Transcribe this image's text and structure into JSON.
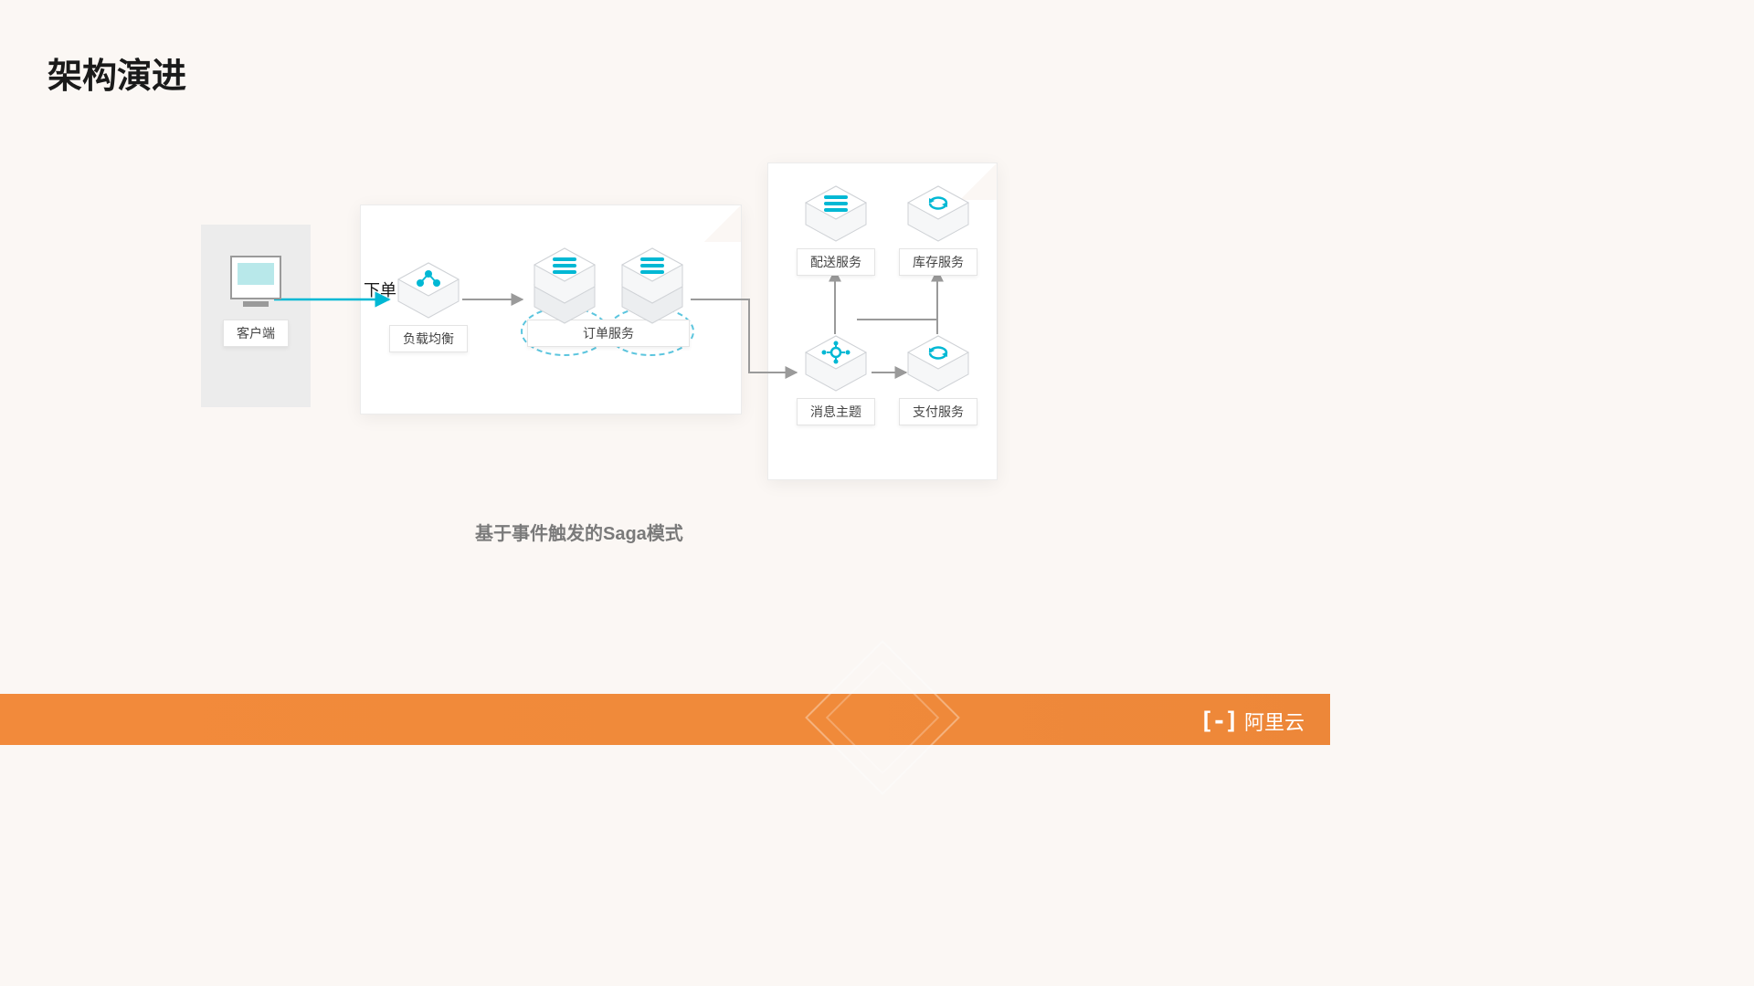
{
  "title": "架构演进",
  "caption": "基于事件触发的Saga模式",
  "footer_brand": "阿里云",
  "edge_label_order": "下单",
  "nodes": {
    "client": "客户端",
    "lb": "负载均衡",
    "order": "订单服务",
    "delivery": "配送服务",
    "inventory": "库存服务",
    "topic": "消息主题",
    "payment": "支付服务"
  },
  "colors": {
    "accent": "#00b8d4",
    "footer": "#f28a3b",
    "line_gray": "#9a9a9a",
    "hex_top": "#f3f4f5",
    "hex_side": "#d8dadd"
  }
}
